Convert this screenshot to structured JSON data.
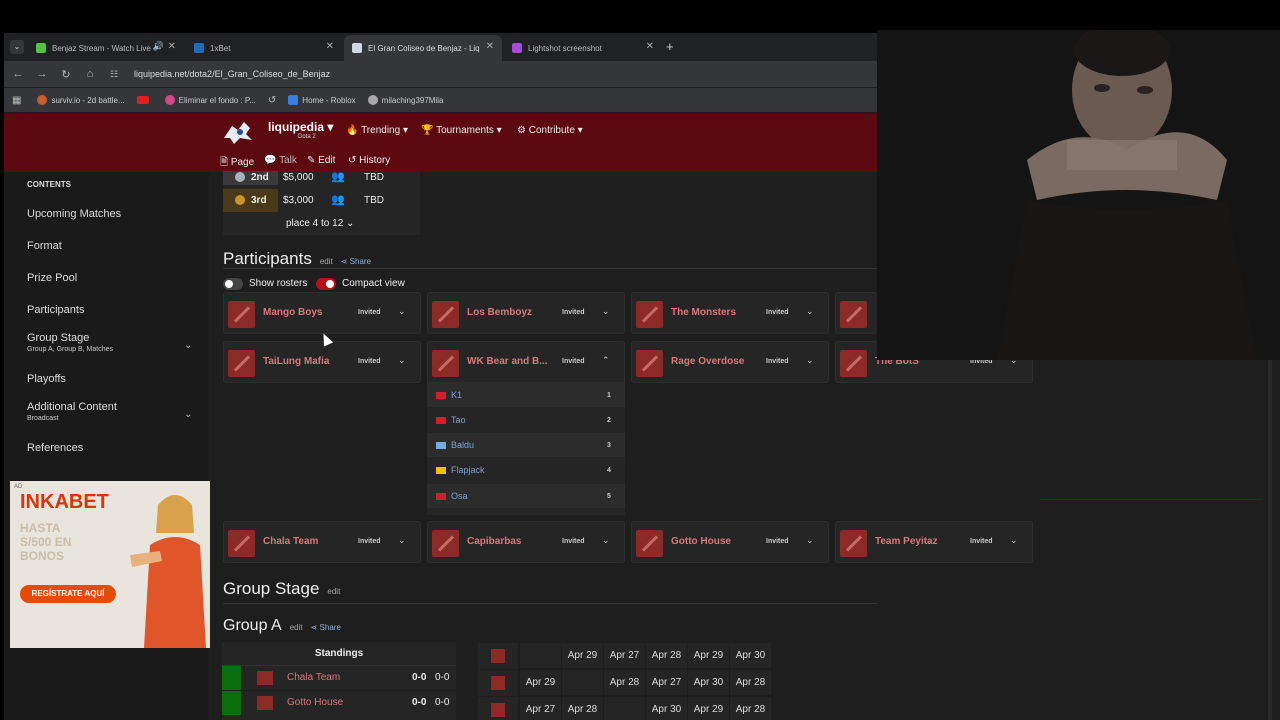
{
  "browser": {
    "tabs": [
      {
        "label": "Benjaz Stream - Watch Live",
        "color": "#53c43f",
        "active": false
      },
      {
        "label": "1xBet",
        "color": "#1e6fb8",
        "active": false
      },
      {
        "label": "El Gran Coliseo de Benjaz - Liq",
        "color": "#cfd8e6",
        "active": true
      },
      {
        "label": "Lightshot screenshot",
        "color": "#a54bd8",
        "active": false
      }
    ],
    "new_tab": "+",
    "url": "liquipedia.net/dota2/El_Gran_Coliseo_de_Benjaz",
    "bookmarks": [
      {
        "label": "surviv.io - 2d battle...",
        "color": "#c85d2b"
      },
      {
        "label": "",
        "color": "#e02020"
      },
      {
        "label": "Eliminar el fondo : P...",
        "color": "#d04a8a"
      },
      {
        "label": "Home - Roblox",
        "color": "#3a7be0"
      },
      {
        "label": "milaching397Mila",
        "color": "#aaaaaa"
      }
    ]
  },
  "liquipedia": {
    "brand": "liquipedia",
    "game": "Dota 2",
    "menu": [
      "Trending",
      "Tournaments",
      "Contribute"
    ],
    "subnav": [
      "Page",
      "Talk",
      "Edit",
      "History"
    ]
  },
  "sidebar": {
    "contents_label": "CONTENTS",
    "items": [
      {
        "label": "Upcoming Matches",
        "sub": ""
      },
      {
        "label": "Format",
        "sub": ""
      },
      {
        "label": "Prize Pool",
        "sub": ""
      },
      {
        "label": "Participants",
        "sub": ""
      },
      {
        "label": "Group Stage",
        "sub": "Group A, Group B, Matches"
      },
      {
        "label": "Playoffs",
        "sub": ""
      },
      {
        "label": "Additional Content",
        "sub": "Broadcast"
      },
      {
        "label": "References",
        "sub": ""
      }
    ]
  },
  "ad": {
    "tag": "AD",
    "logo": "INKABET",
    "line1": "HASTA",
    "line2": "S/500 EN",
    "line3": "BONOS",
    "button": "REGÍSTRATE AQUÍ"
  },
  "prize": {
    "rows": [
      {
        "place": "2nd",
        "amount": "$5,000",
        "team": "TBD",
        "medal": "#a9b4bf"
      },
      {
        "place": "3rd",
        "amount": "$3,000",
        "team": "TBD",
        "medal": "#c9952c"
      }
    ],
    "more": "place 4 to 12"
  },
  "participants": {
    "title": "Participants",
    "edit": "edit",
    "share": "Share",
    "show_rosters": "Show rosters",
    "compact_view": "Compact view",
    "invited": "Invited",
    "row1": [
      "Mango Boys",
      "Los Bemboyz",
      "The Monsters",
      ""
    ],
    "row2": [
      "TaiLung Mafia",
      "WK Bear and B...",
      "Rage Overdose",
      "The BotS"
    ],
    "row3": [
      "Chala Team",
      "Capibarbas",
      "Gotto House",
      "Team Peyitaz"
    ],
    "roster": [
      {
        "name": "K1",
        "num": "1",
        "flag": "#d21e2b"
      },
      {
        "name": "Tao",
        "num": "2",
        "flag": "#d21e2b"
      },
      {
        "name": "Baldu",
        "num": "3",
        "flag": "#74acdf"
      },
      {
        "name": "Flapjack",
        "num": "4",
        "flag": "#f1bf00"
      },
      {
        "name": "Osa",
        "num": "5",
        "flag": "#d21e2b"
      }
    ]
  },
  "group_stage": {
    "title": "Group Stage",
    "edit": "edit"
  },
  "group_a": {
    "title": "Group A",
    "edit": "edit",
    "share": "Share",
    "standings_label": "Standings",
    "teams": [
      {
        "name": "Chala Team",
        "score1": "0-0",
        "score2": "0-0"
      },
      {
        "name": "Gotto House",
        "score1": "0-0",
        "score2": "0-0"
      }
    ],
    "header_dates": [
      "Apr 29",
      "Apr 27",
      "Apr 28",
      "Apr 29",
      "Apr 30"
    ],
    "row1_dates": [
      "Apr 29",
      "",
      "Apr 28",
      "Apr 27",
      "Apr 30",
      "Apr 28"
    ],
    "row2_dates": [
      "Apr 27",
      "Apr 28",
      "",
      "Apr 30",
      "Apr 29",
      "Apr 28"
    ]
  }
}
